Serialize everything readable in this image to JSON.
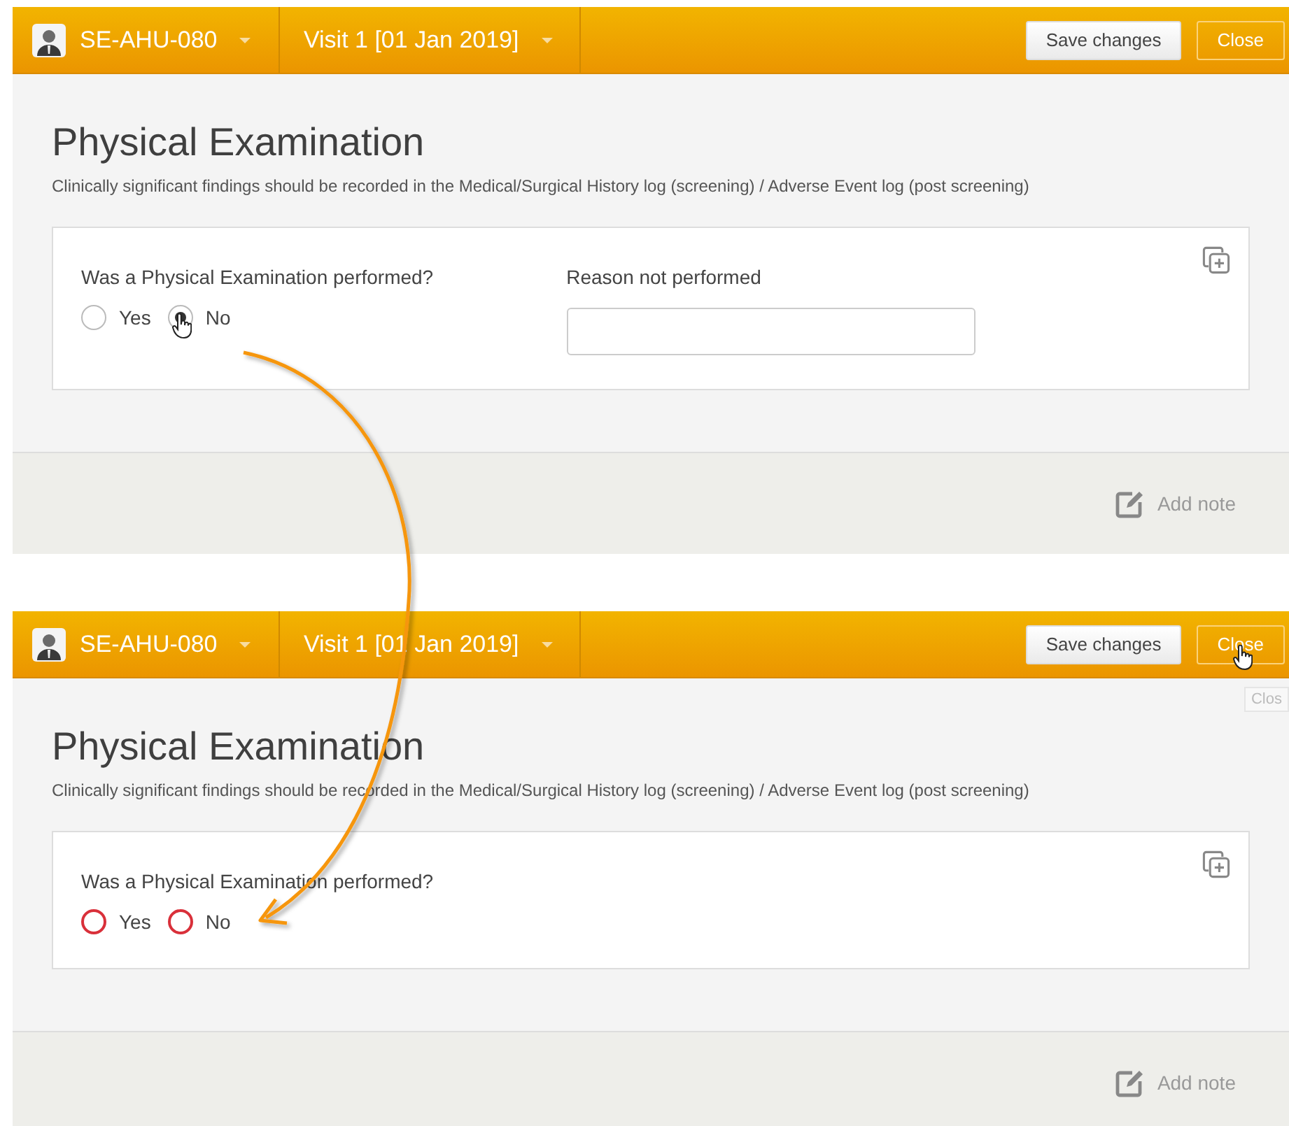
{
  "screens": [
    {
      "header": {
        "subject": "SE-AHU-080",
        "visit": "Visit 1 [01 Jan 2019]",
        "buttons": [
          {
            "label": "Save changes",
            "kind": "primary",
            "hovered": false
          },
          {
            "label": "Close",
            "kind": "outline",
            "hovered": false
          }
        ]
      },
      "title": "Physical Examination",
      "note": "Clinically significant findings should be recorded in the Medical/Surgical History log (screening) / Adverse Event log (post screening)",
      "question": {
        "label": "Was a Physical Examination performed?",
        "options": [
          {
            "label": "Yes",
            "selected": false,
            "error": false,
            "hovered": false
          },
          {
            "label": "No",
            "selected": true,
            "error": false,
            "hovered": true
          }
        ]
      },
      "reason": {
        "label": "Reason not performed"
      },
      "add_note": "Add note"
    },
    {
      "header": {
        "subject": "SE-AHU-080",
        "visit": "Visit 1 [01 Jan 2019]",
        "buttons": [
          {
            "label": "Save changes",
            "kind": "primary",
            "hovered": false
          },
          {
            "label": "Close",
            "kind": "outline",
            "hovered": true
          }
        ]
      },
      "tooltip": "Clos",
      "title": "Physical Examination",
      "note": "Clinically significant findings should be recorded in the Medical/Surgical History log (screening) / Adverse Event log (post screening)",
      "question": {
        "label": "Was a Physical Examination performed?",
        "options": [
          {
            "label": "Yes",
            "selected": false,
            "error": true,
            "hovered": false
          },
          {
            "label": "No",
            "selected": false,
            "error": true,
            "hovered": false
          }
        ]
      },
      "add_note": "Add note"
    }
  ]
}
